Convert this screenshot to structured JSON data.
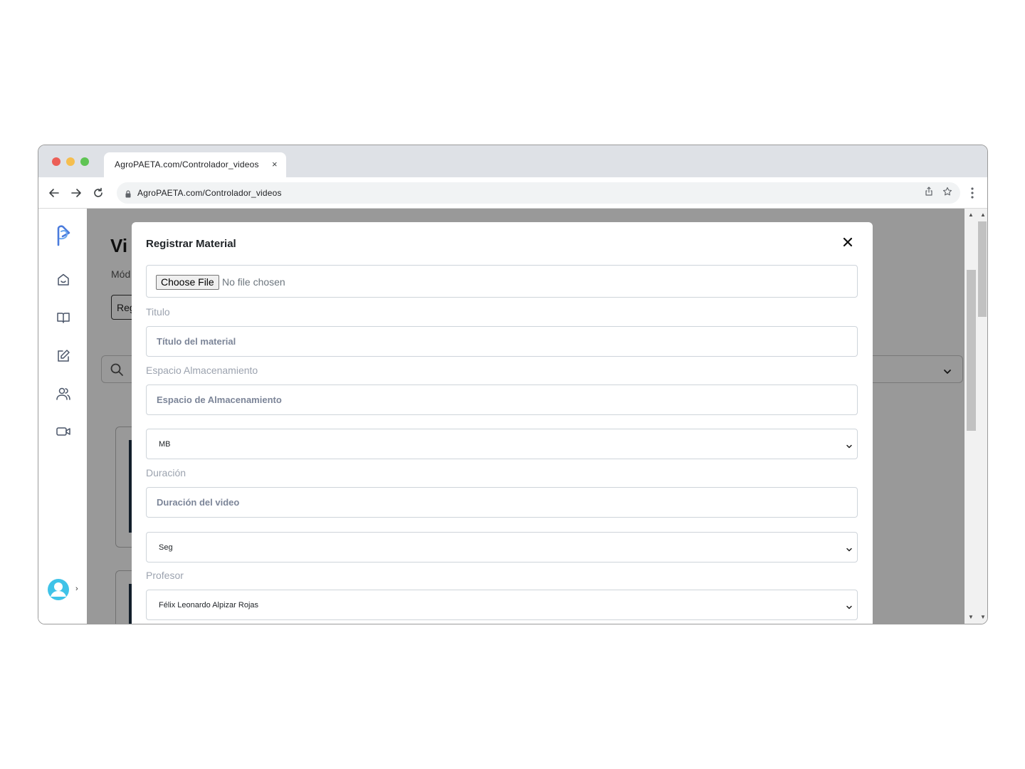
{
  "browser": {
    "tab_title": "AgroPAETA.com/Controlador_videos",
    "tab_close": "×",
    "url": "AgroPAETA.com/Controlador_videos"
  },
  "page": {
    "title": "Vi",
    "subtitle": "Mód",
    "button_label": "Reg"
  },
  "sidebar": {
    "items": [
      {
        "icon": "home-icon"
      },
      {
        "icon": "book-icon"
      },
      {
        "icon": "edit-icon"
      },
      {
        "icon": "users-icon"
      },
      {
        "icon": "video-icon"
      }
    ],
    "user_chevron": "›"
  },
  "modal": {
    "title": "Registrar Material",
    "file": {
      "button_label": "Choose File",
      "status": "No file chosen"
    },
    "titulo": {
      "label": "Titulo",
      "placeholder": "Título del material"
    },
    "espacio": {
      "label": "Espacio Almacenamiento",
      "placeholder": "Espacio de Almacenamiento",
      "unit_selected": "MB"
    },
    "duracion": {
      "label": "Duración",
      "placeholder": "Duración del video",
      "unit_selected": "Seg"
    },
    "profesor": {
      "label": "Profesor",
      "selected": "Félix Leonardo Alpizar Rojas"
    }
  },
  "colors": {
    "accent": "#4a7bdc",
    "overlay": "rgba(0,0,0,0.40)",
    "avatar": "#3fc3e8"
  }
}
